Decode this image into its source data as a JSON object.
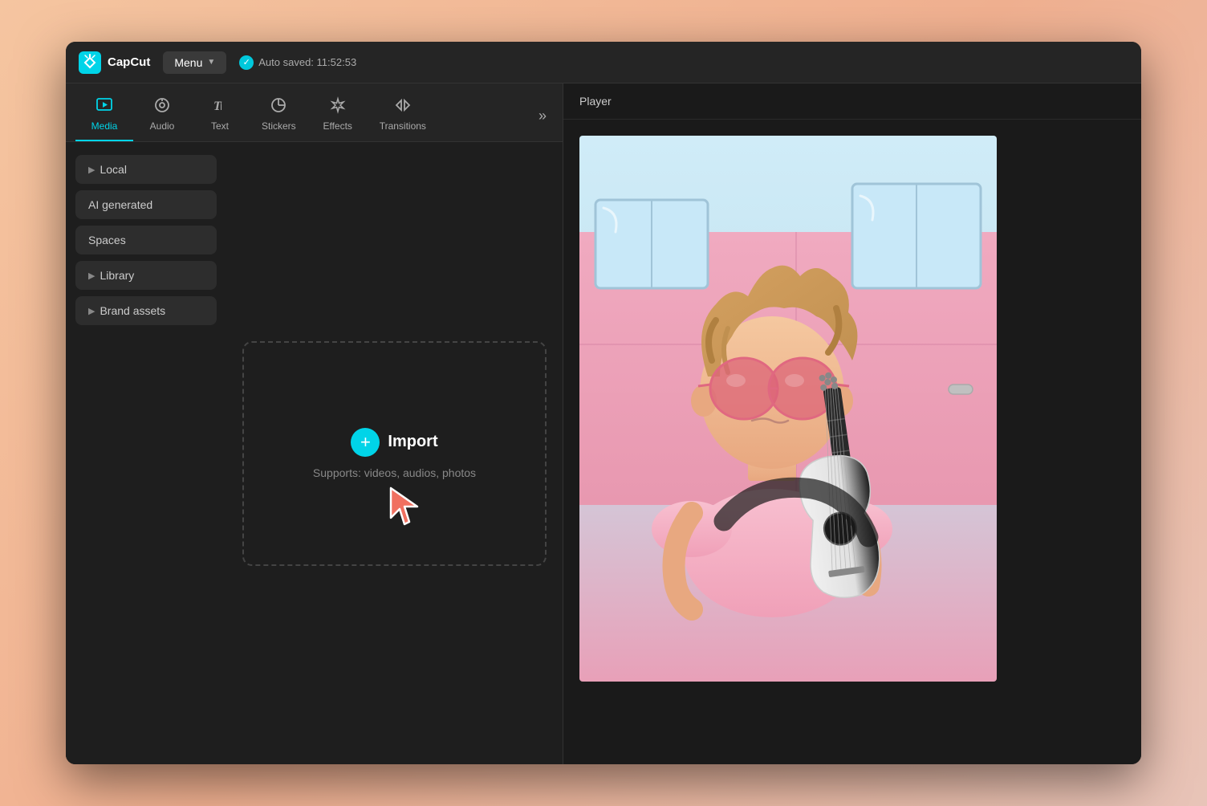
{
  "app": {
    "logo_text": "CapCut",
    "menu_label": "Menu",
    "autosave_text": "Auto saved: 11:52:53"
  },
  "tabs": [
    {
      "id": "media",
      "label": "Media",
      "icon": "▶",
      "active": true
    },
    {
      "id": "audio",
      "label": "Audio",
      "icon": "◎"
    },
    {
      "id": "text",
      "label": "Text",
      "icon": "TI"
    },
    {
      "id": "stickers",
      "label": "Stickers",
      "icon": "◷"
    },
    {
      "id": "effects",
      "label": "Effects",
      "icon": "✦"
    },
    {
      "id": "transitions",
      "label": "Transitions",
      "icon": "⋈"
    }
  ],
  "sidebar": {
    "items": [
      {
        "id": "local",
        "label": "Local",
        "arrow": "▶"
      },
      {
        "id": "ai-generated",
        "label": "AI generated"
      },
      {
        "id": "spaces",
        "label": "Spaces"
      },
      {
        "id": "library",
        "label": "Library",
        "arrow": "▶"
      },
      {
        "id": "brand-assets",
        "label": "Brand assets",
        "arrow": "▶"
      }
    ]
  },
  "import": {
    "plus_icon": "+",
    "label": "Import",
    "subtitle": "Supports: videos, audios, photos"
  },
  "player": {
    "title": "Player"
  },
  "colors": {
    "accent": "#00d4e8",
    "bg_dark": "#1e1e1e",
    "bg_medium": "#252525",
    "text_primary": "#ffffff",
    "text_secondary": "#aaaaaa"
  }
}
